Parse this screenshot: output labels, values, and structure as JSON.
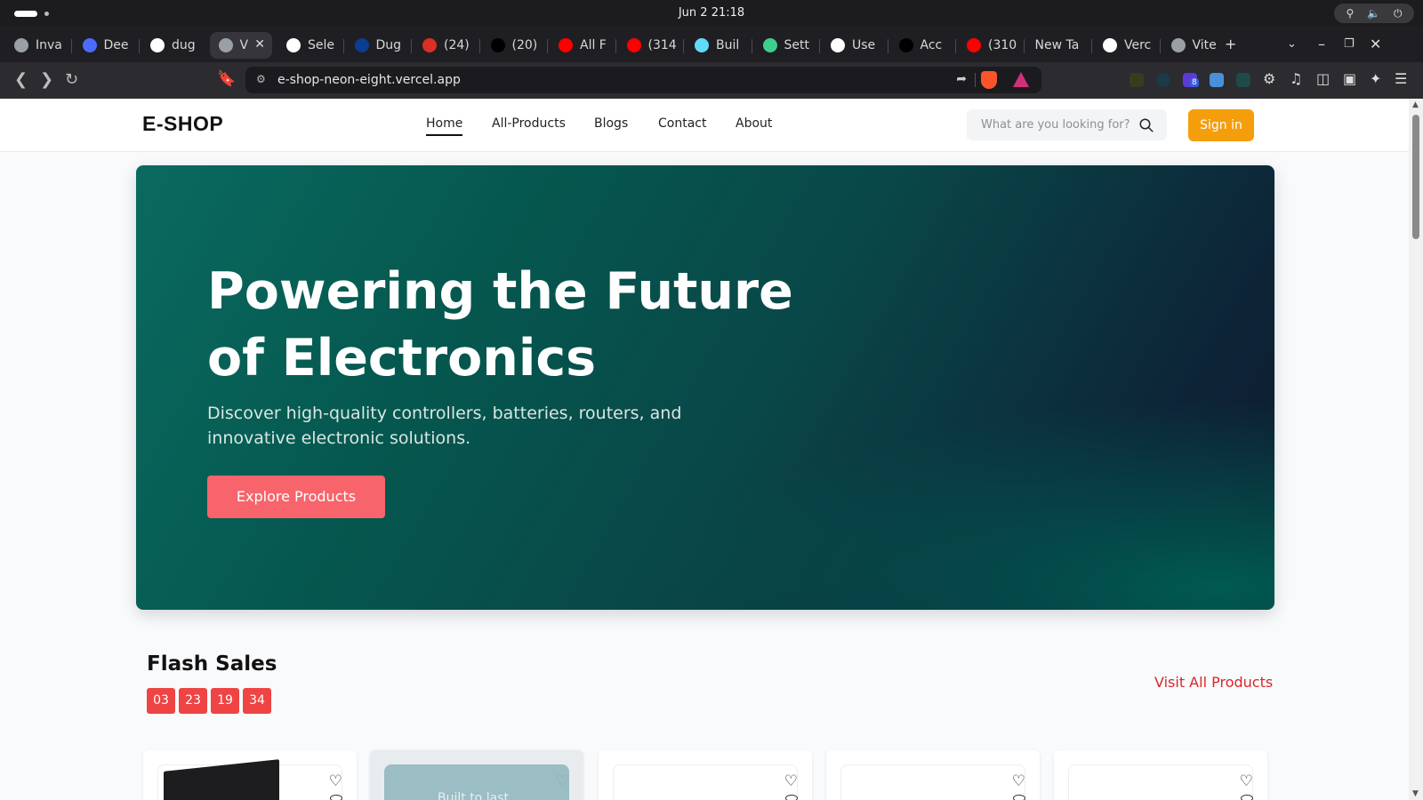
{
  "os": {
    "clock": "Jun 2  21:18"
  },
  "browser": {
    "tabs": [
      {
        "label": "Inva",
        "icon": "generic-icon",
        "color": "#9aa0a6"
      },
      {
        "label": "Dee",
        "icon": "deepseek-icon",
        "color": "#4d6bfe"
      },
      {
        "label": "dug",
        "icon": "github-icon",
        "color": "#ffffff"
      },
      {
        "label": "V",
        "icon": "globe-icon",
        "color": "#9aa0a6",
        "active": true
      },
      {
        "label": "Sele",
        "icon": "figma-icon",
        "color": "#ffffff"
      },
      {
        "label": "Dug",
        "icon": "dugout-icon",
        "color": "#0b3d91"
      },
      {
        "label": "(24)",
        "icon": "notifications-icon",
        "color": "#d93025"
      },
      {
        "label": "(20)",
        "icon": "x-icon",
        "color": "#000000"
      },
      {
        "label": "All F",
        "icon": "youtube-icon",
        "color": "#ff0000"
      },
      {
        "label": "(314",
        "icon": "youtube-icon",
        "color": "#ff0000"
      },
      {
        "label": "Buil",
        "icon": "react-icon",
        "color": "#61dafb"
      },
      {
        "label": "Sett",
        "icon": "supabase-icon",
        "color": "#3ecf8e"
      },
      {
        "label": "Use",
        "icon": "bolt-icon",
        "color": "#ffffff"
      },
      {
        "label": "Acc",
        "icon": "ui-icon",
        "color": "#000000"
      },
      {
        "label": "(310",
        "icon": "youtube-icon",
        "color": "#ff0000"
      },
      {
        "label": "New Ta",
        "icon": "",
        "color": ""
      },
      {
        "label": "Verc",
        "icon": "vercel-icon",
        "color": "#ffffff"
      },
      {
        "label": "Vite",
        "icon": "globe-icon",
        "color": "#9aa0a6"
      }
    ],
    "url": "e-shop-neon-eight.vercel.app",
    "extension_badge": "8"
  },
  "site": {
    "logo": "E-SHOP",
    "nav": [
      "Home",
      "All-Products",
      "Blogs",
      "Contact",
      "About"
    ],
    "active_nav": "Home",
    "search_placeholder": "What are you looking for?",
    "signin_label": "Sign in",
    "colors": {
      "accent": "#f59e0b",
      "hero_button": "#f8646c",
      "countdown": "#ef4444",
      "link": "#dc2626"
    }
  },
  "hero": {
    "title": "Powering the Future of Electronics",
    "subtitle": "Discover high-quality controllers, batteries, routers, and innovative electronic solutions.",
    "cta": "Explore Products"
  },
  "flash_sales": {
    "title": "Flash Sales",
    "countdown": [
      "03",
      "23",
      "19",
      "34"
    ],
    "visit_all": "Visit All Products",
    "card_2_caption": "Built to last"
  }
}
